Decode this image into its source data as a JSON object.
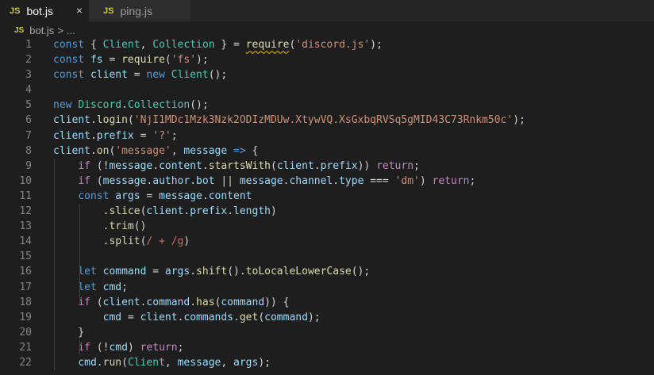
{
  "tabs": [
    {
      "icon": "JS",
      "label": "bot.js",
      "active": true
    },
    {
      "icon": "JS",
      "label": "ping.js",
      "active": false
    }
  ],
  "tab_close": "×",
  "breadcrumb": {
    "icon": "JS",
    "file": "bot.js",
    "sep": ">",
    "more": "..."
  },
  "colors": {
    "keyword": "#569cd6",
    "function": "#dcdcaa",
    "variable": "#9cdcfe",
    "string": "#ce9178",
    "class": "#4ec9b0",
    "control": "#c586c0"
  },
  "lines": [
    {
      "n": "1",
      "tokens": [
        [
          "k",
          "const "
        ],
        [
          "p",
          "{ "
        ],
        [
          "t",
          "Client"
        ],
        [
          "p",
          ", "
        ],
        [
          "t",
          "Collection"
        ],
        [
          "p",
          " } = "
        ],
        [
          "fsq",
          "require"
        ],
        [
          "p",
          "("
        ],
        [
          "s",
          "'discord.js'"
        ],
        [
          "p",
          ");"
        ]
      ]
    },
    {
      "n": "2",
      "tokens": [
        [
          "k",
          "const "
        ],
        [
          "v",
          "fs"
        ],
        [
          "p",
          " = "
        ],
        [
          "f",
          "require"
        ],
        [
          "p",
          "("
        ],
        [
          "s",
          "'fs'"
        ],
        [
          "p",
          ");"
        ]
      ]
    },
    {
      "n": "3",
      "tokens": [
        [
          "k",
          "const "
        ],
        [
          "v",
          "client"
        ],
        [
          "p",
          " = "
        ],
        [
          "k",
          "new "
        ],
        [
          "t",
          "Client"
        ],
        [
          "p",
          "();"
        ]
      ]
    },
    {
      "n": "4",
      "tokens": []
    },
    {
      "n": "5",
      "tokens": [
        [
          "k",
          "new "
        ],
        [
          "t",
          "Discord"
        ],
        [
          "p",
          "."
        ],
        [
          "t",
          "Collection"
        ],
        [
          "p",
          "();"
        ]
      ]
    },
    {
      "n": "6",
      "tokens": [
        [
          "v",
          "client"
        ],
        [
          "p",
          "."
        ],
        [
          "f",
          "login"
        ],
        [
          "p",
          "("
        ],
        [
          "s",
          "'NjI1MDc1Mzk3Nzk2ODIzMDUw.XtywVQ.XsGxbqRVSq5gMID43C73Rnkm50c'"
        ],
        [
          "p",
          ");"
        ]
      ]
    },
    {
      "n": "7",
      "tokens": [
        [
          "v",
          "client"
        ],
        [
          "p",
          "."
        ],
        [
          "v",
          "prefix"
        ],
        [
          "p",
          " = "
        ],
        [
          "s",
          "'?'"
        ],
        [
          "p",
          ";"
        ]
      ]
    },
    {
      "n": "8",
      "tokens": [
        [
          "v",
          "client"
        ],
        [
          "p",
          "."
        ],
        [
          "f",
          "on"
        ],
        [
          "p",
          "("
        ],
        [
          "s",
          "'message'"
        ],
        [
          "p",
          ", "
        ],
        [
          "v",
          "message"
        ],
        [
          "p",
          " "
        ],
        [
          "k",
          "=>"
        ],
        [
          "p",
          " {"
        ]
      ]
    },
    {
      "n": "9",
      "tokens": [
        [
          "p",
          "    "
        ],
        [
          "c",
          "if"
        ],
        [
          "p",
          " (!"
        ],
        [
          "v",
          "message"
        ],
        [
          "p",
          "."
        ],
        [
          "v",
          "content"
        ],
        [
          "p",
          "."
        ],
        [
          "f",
          "startsWith"
        ],
        [
          "p",
          "("
        ],
        [
          "v",
          "client"
        ],
        [
          "p",
          "."
        ],
        [
          "v",
          "prefix"
        ],
        [
          "p",
          ")) "
        ],
        [
          "c",
          "return"
        ],
        [
          "p",
          ";"
        ]
      ]
    },
    {
      "n": "10",
      "tokens": [
        [
          "p",
          "    "
        ],
        [
          "c",
          "if"
        ],
        [
          "p",
          " ("
        ],
        [
          "v",
          "message"
        ],
        [
          "p",
          "."
        ],
        [
          "v",
          "author"
        ],
        [
          "p",
          "."
        ],
        [
          "v",
          "bot"
        ],
        [
          "p",
          " || "
        ],
        [
          "v",
          "message"
        ],
        [
          "p",
          "."
        ],
        [
          "v",
          "channel"
        ],
        [
          "p",
          "."
        ],
        [
          "v",
          "type"
        ],
        [
          "p",
          " === "
        ],
        [
          "s",
          "'dm'"
        ],
        [
          "p",
          ") "
        ],
        [
          "c",
          "return"
        ],
        [
          "p",
          ";"
        ]
      ]
    },
    {
      "n": "11",
      "tokens": [
        [
          "p",
          "    "
        ],
        [
          "k",
          "const "
        ],
        [
          "v",
          "args"
        ],
        [
          "p",
          " = "
        ],
        [
          "v",
          "message"
        ],
        [
          "p",
          "."
        ],
        [
          "v",
          "content"
        ]
      ]
    },
    {
      "n": "12",
      "tokens": [
        [
          "p",
          "        ."
        ],
        [
          "f",
          "slice"
        ],
        [
          "p",
          "("
        ],
        [
          "v",
          "client"
        ],
        [
          "p",
          "."
        ],
        [
          "v",
          "prefix"
        ],
        [
          "p",
          "."
        ],
        [
          "v",
          "length"
        ],
        [
          "p",
          ")"
        ]
      ]
    },
    {
      "n": "13",
      "tokens": [
        [
          "p",
          "        ."
        ],
        [
          "f",
          "trim"
        ],
        [
          "p",
          "()"
        ]
      ]
    },
    {
      "n": "14",
      "tokens": [
        [
          "p",
          "        ."
        ],
        [
          "f",
          "split"
        ],
        [
          "p",
          "("
        ],
        [
          "r",
          "/ + /g"
        ],
        [
          "p",
          ")"
        ]
      ]
    },
    {
      "n": "15",
      "tokens": []
    },
    {
      "n": "16",
      "tokens": [
        [
          "p",
          "    "
        ],
        [
          "k",
          "let "
        ],
        [
          "v",
          "command"
        ],
        [
          "p",
          " = "
        ],
        [
          "v",
          "args"
        ],
        [
          "p",
          "."
        ],
        [
          "f",
          "shift"
        ],
        [
          "p",
          "()."
        ],
        [
          "f",
          "toLocaleLowerCase"
        ],
        [
          "p",
          "();"
        ]
      ]
    },
    {
      "n": "17",
      "tokens": [
        [
          "p",
          "    "
        ],
        [
          "k",
          "let "
        ],
        [
          "v",
          "cmd"
        ],
        [
          "p",
          ";"
        ]
      ]
    },
    {
      "n": "18",
      "tokens": [
        [
          "p",
          "    "
        ],
        [
          "c",
          "if"
        ],
        [
          "p",
          " ("
        ],
        [
          "v",
          "client"
        ],
        [
          "p",
          "."
        ],
        [
          "v",
          "command"
        ],
        [
          "p",
          "."
        ],
        [
          "f",
          "has"
        ],
        [
          "p",
          "("
        ],
        [
          "v",
          "command"
        ],
        [
          "p",
          ")) {"
        ]
      ]
    },
    {
      "n": "19",
      "tokens": [
        [
          "p",
          "        "
        ],
        [
          "v",
          "cmd"
        ],
        [
          "p",
          " = "
        ],
        [
          "v",
          "client"
        ],
        [
          "p",
          "."
        ],
        [
          "v",
          "commands"
        ],
        [
          "p",
          "."
        ],
        [
          "f",
          "get"
        ],
        [
          "p",
          "("
        ],
        [
          "v",
          "command"
        ],
        [
          "p",
          ");"
        ]
      ]
    },
    {
      "n": "20",
      "tokens": [
        [
          "p",
          "    }"
        ]
      ]
    },
    {
      "n": "21",
      "tokens": [
        [
          "p",
          "    "
        ],
        [
          "c",
          "if"
        ],
        [
          "p",
          " (!"
        ],
        [
          "v",
          "cmd"
        ],
        [
          "p",
          ") "
        ],
        [
          "c",
          "return"
        ],
        [
          "p",
          ";"
        ]
      ]
    },
    {
      "n": "22",
      "tokens": [
        [
          "p",
          "    "
        ],
        [
          "v",
          "cmd"
        ],
        [
          "p",
          "."
        ],
        [
          "f",
          "run"
        ],
        [
          "p",
          "("
        ],
        [
          "t",
          "Client"
        ],
        [
          "p",
          ", "
        ],
        [
          "v",
          "message"
        ],
        [
          "p",
          ", "
        ],
        [
          "v",
          "args"
        ],
        [
          "p",
          ");"
        ]
      ]
    }
  ]
}
